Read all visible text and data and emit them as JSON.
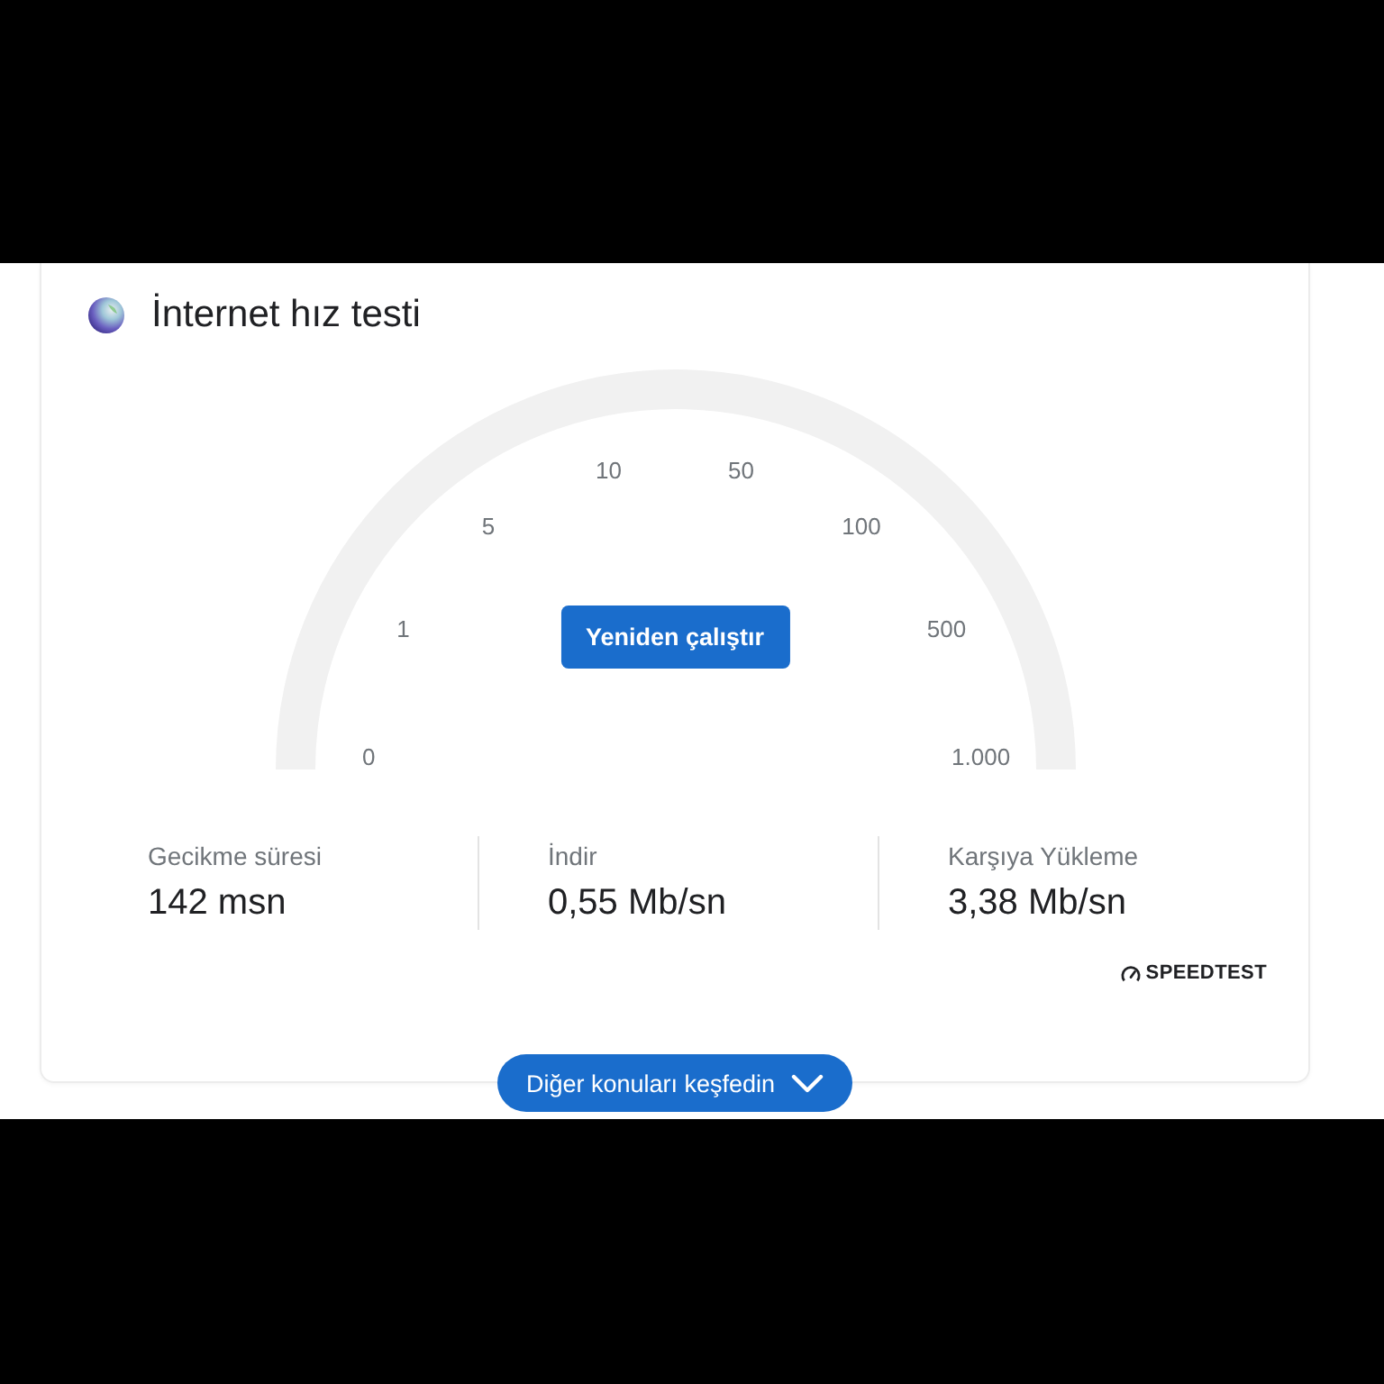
{
  "header": {
    "title": "İnternet hız testi"
  },
  "gauge": {
    "scale_labels": [
      "0",
      "1",
      "5",
      "10",
      "50",
      "100",
      "500",
      "1.000"
    ],
    "button": "Yeniden çalıştır"
  },
  "stats": [
    {
      "label": "Gecikme süresi",
      "value": "142 msn"
    },
    {
      "label": "İndir",
      "value": "0,55 Mb/sn"
    },
    {
      "label": "Karşıya Yükleme",
      "value": "3,38 Mb/sn"
    }
  ],
  "provider": "SPEEDTEST",
  "explore_button": {
    "label": "Diğer konuları keşfedin",
    "expanded": false
  }
}
